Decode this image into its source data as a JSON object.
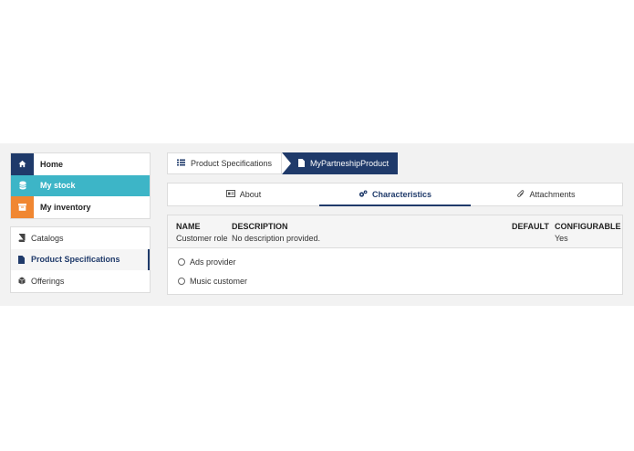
{
  "main_menu": {
    "items": [
      {
        "label": "Home",
        "icon": "home-icon"
      },
      {
        "label": "My stock",
        "icon": "database-icon"
      },
      {
        "label": "My inventory",
        "icon": "box-icon"
      }
    ]
  },
  "sub_menu": {
    "items": [
      {
        "label": "Catalogs",
        "icon": "book-icon"
      },
      {
        "label": "Product Specifications",
        "icon": "file-icon"
      },
      {
        "label": "Offerings",
        "icon": "cube-icon"
      }
    ]
  },
  "breadcrumb": {
    "first": "Product Specifications",
    "current": "MyPartneshipProduct"
  },
  "tabs": [
    {
      "label": "About",
      "icon": "id-card-icon"
    },
    {
      "label": "Characteristics",
      "icon": "cogs-icon"
    },
    {
      "label": "Attachments",
      "icon": "paperclip-icon"
    }
  ],
  "characteristic": {
    "headers": {
      "name": "NAME",
      "description": "DESCRIPTION",
      "default": "DEFAULT",
      "configurable": "CONFIGURABLE"
    },
    "name": "Customer role",
    "description": "No description provided.",
    "configurable": "Yes",
    "options": [
      "Ads provider",
      "Music customer"
    ]
  },
  "colors": {
    "navy": "#1f3a6a",
    "teal": "#3db5c7",
    "orange": "#f08732"
  }
}
